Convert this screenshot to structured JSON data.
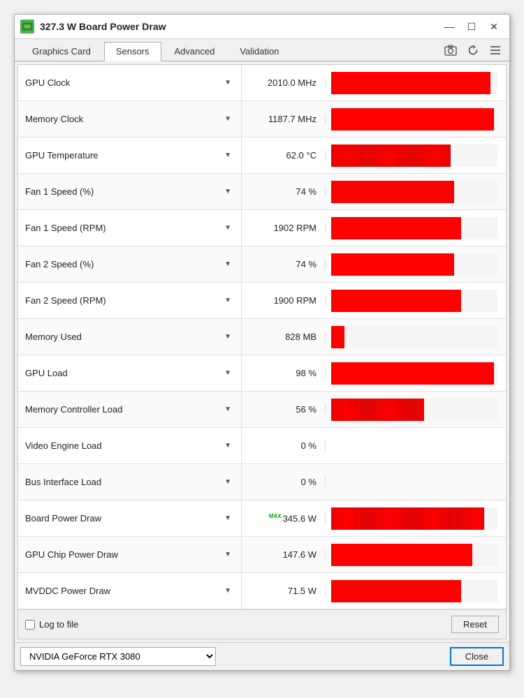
{
  "window": {
    "title": "327.3 W Board Power Draw",
    "icon": "GPU"
  },
  "titleControls": {
    "minimize": "—",
    "maximize": "☐",
    "close": "✕"
  },
  "tabs": [
    {
      "id": "graphics-card",
      "label": "Graphics Card",
      "active": false
    },
    {
      "id": "sensors",
      "label": "Sensors",
      "active": true
    },
    {
      "id": "advanced",
      "label": "Advanced",
      "active": false
    },
    {
      "id": "validation",
      "label": "Validation",
      "active": false
    }
  ],
  "tabActions": {
    "camera": "📷",
    "refresh": "↻",
    "menu": "≡"
  },
  "sensors": [
    {
      "id": "gpu-clock",
      "name": "GPU Clock",
      "value": "2010.0 MHz",
      "barPct": 96,
      "barType": "solid",
      "hasNoise": false,
      "hasMax": false
    },
    {
      "id": "memory-clock",
      "name": "Memory Clock",
      "value": "1187.7 MHz",
      "barPct": 98,
      "barType": "solid",
      "hasNoise": false,
      "hasMax": false
    },
    {
      "id": "gpu-temperature",
      "name": "GPU Temperature",
      "value": "62.0 °C",
      "barPct": 72,
      "barType": "noisy",
      "hasNoise": true,
      "hasMax": false
    },
    {
      "id": "fan1-speed-pct",
      "name": "Fan 1 Speed (%)",
      "value": "74 %",
      "barPct": 74,
      "barType": "solid",
      "hasNoise": false,
      "hasMax": false
    },
    {
      "id": "fan1-speed-rpm",
      "name": "Fan 1 Speed (RPM)",
      "value": "1902 RPM",
      "barPct": 78,
      "barType": "solid",
      "hasNoise": false,
      "hasMax": false
    },
    {
      "id": "fan2-speed-pct",
      "name": "Fan 2 Speed (%)",
      "value": "74 %",
      "barPct": 74,
      "barType": "solid",
      "hasNoise": false,
      "hasMax": false
    },
    {
      "id": "fan2-speed-rpm",
      "name": "Fan 2 Speed (RPM)",
      "value": "1900 RPM",
      "barPct": 78,
      "barType": "solid",
      "hasNoise": false,
      "hasMax": false
    },
    {
      "id": "memory-used",
      "name": "Memory Used",
      "value": "828 MB",
      "barPct": 8,
      "barType": "solid",
      "hasNoise": false,
      "hasMax": false
    },
    {
      "id": "gpu-load",
      "name": "GPU Load",
      "value": "98 %",
      "barPct": 98,
      "barType": "solid",
      "hasNoise": false,
      "hasMax": false
    },
    {
      "id": "memory-controller-load",
      "name": "Memory Controller Load",
      "value": "56 %",
      "barPct": 56,
      "barType": "noisy",
      "hasNoise": true,
      "hasMax": false
    },
    {
      "id": "video-engine-load",
      "name": "Video Engine Load",
      "value": "0 %",
      "barPct": 0,
      "barType": "solid",
      "hasNoise": false,
      "hasMax": false
    },
    {
      "id": "bus-interface-load",
      "name": "Bus Interface Load",
      "value": "0 %",
      "barPct": 0,
      "barType": "solid",
      "hasNoise": false,
      "hasMax": false
    },
    {
      "id": "board-power-draw",
      "name": "Board Power Draw",
      "value": "345.6 W",
      "barPct": 92,
      "barType": "noisy",
      "hasNoise": true,
      "hasMax": true
    },
    {
      "id": "gpu-chip-power-draw",
      "name": "GPU Chip Power Draw",
      "value": "147.6 W",
      "barPct": 85,
      "barType": "solid",
      "hasNoise": false,
      "hasMax": false
    },
    {
      "id": "mvddc-power-draw",
      "name": "MVDDC Power Draw",
      "value": "71.5 W",
      "barPct": 78,
      "barType": "solid",
      "hasNoise": false,
      "hasMax": false
    }
  ],
  "bottomBar": {
    "logLabel": "Log to file",
    "resetLabel": "Reset"
  },
  "footer": {
    "gpuName": "NVIDIA GeForce RTX 3080",
    "closeLabel": "Close"
  }
}
